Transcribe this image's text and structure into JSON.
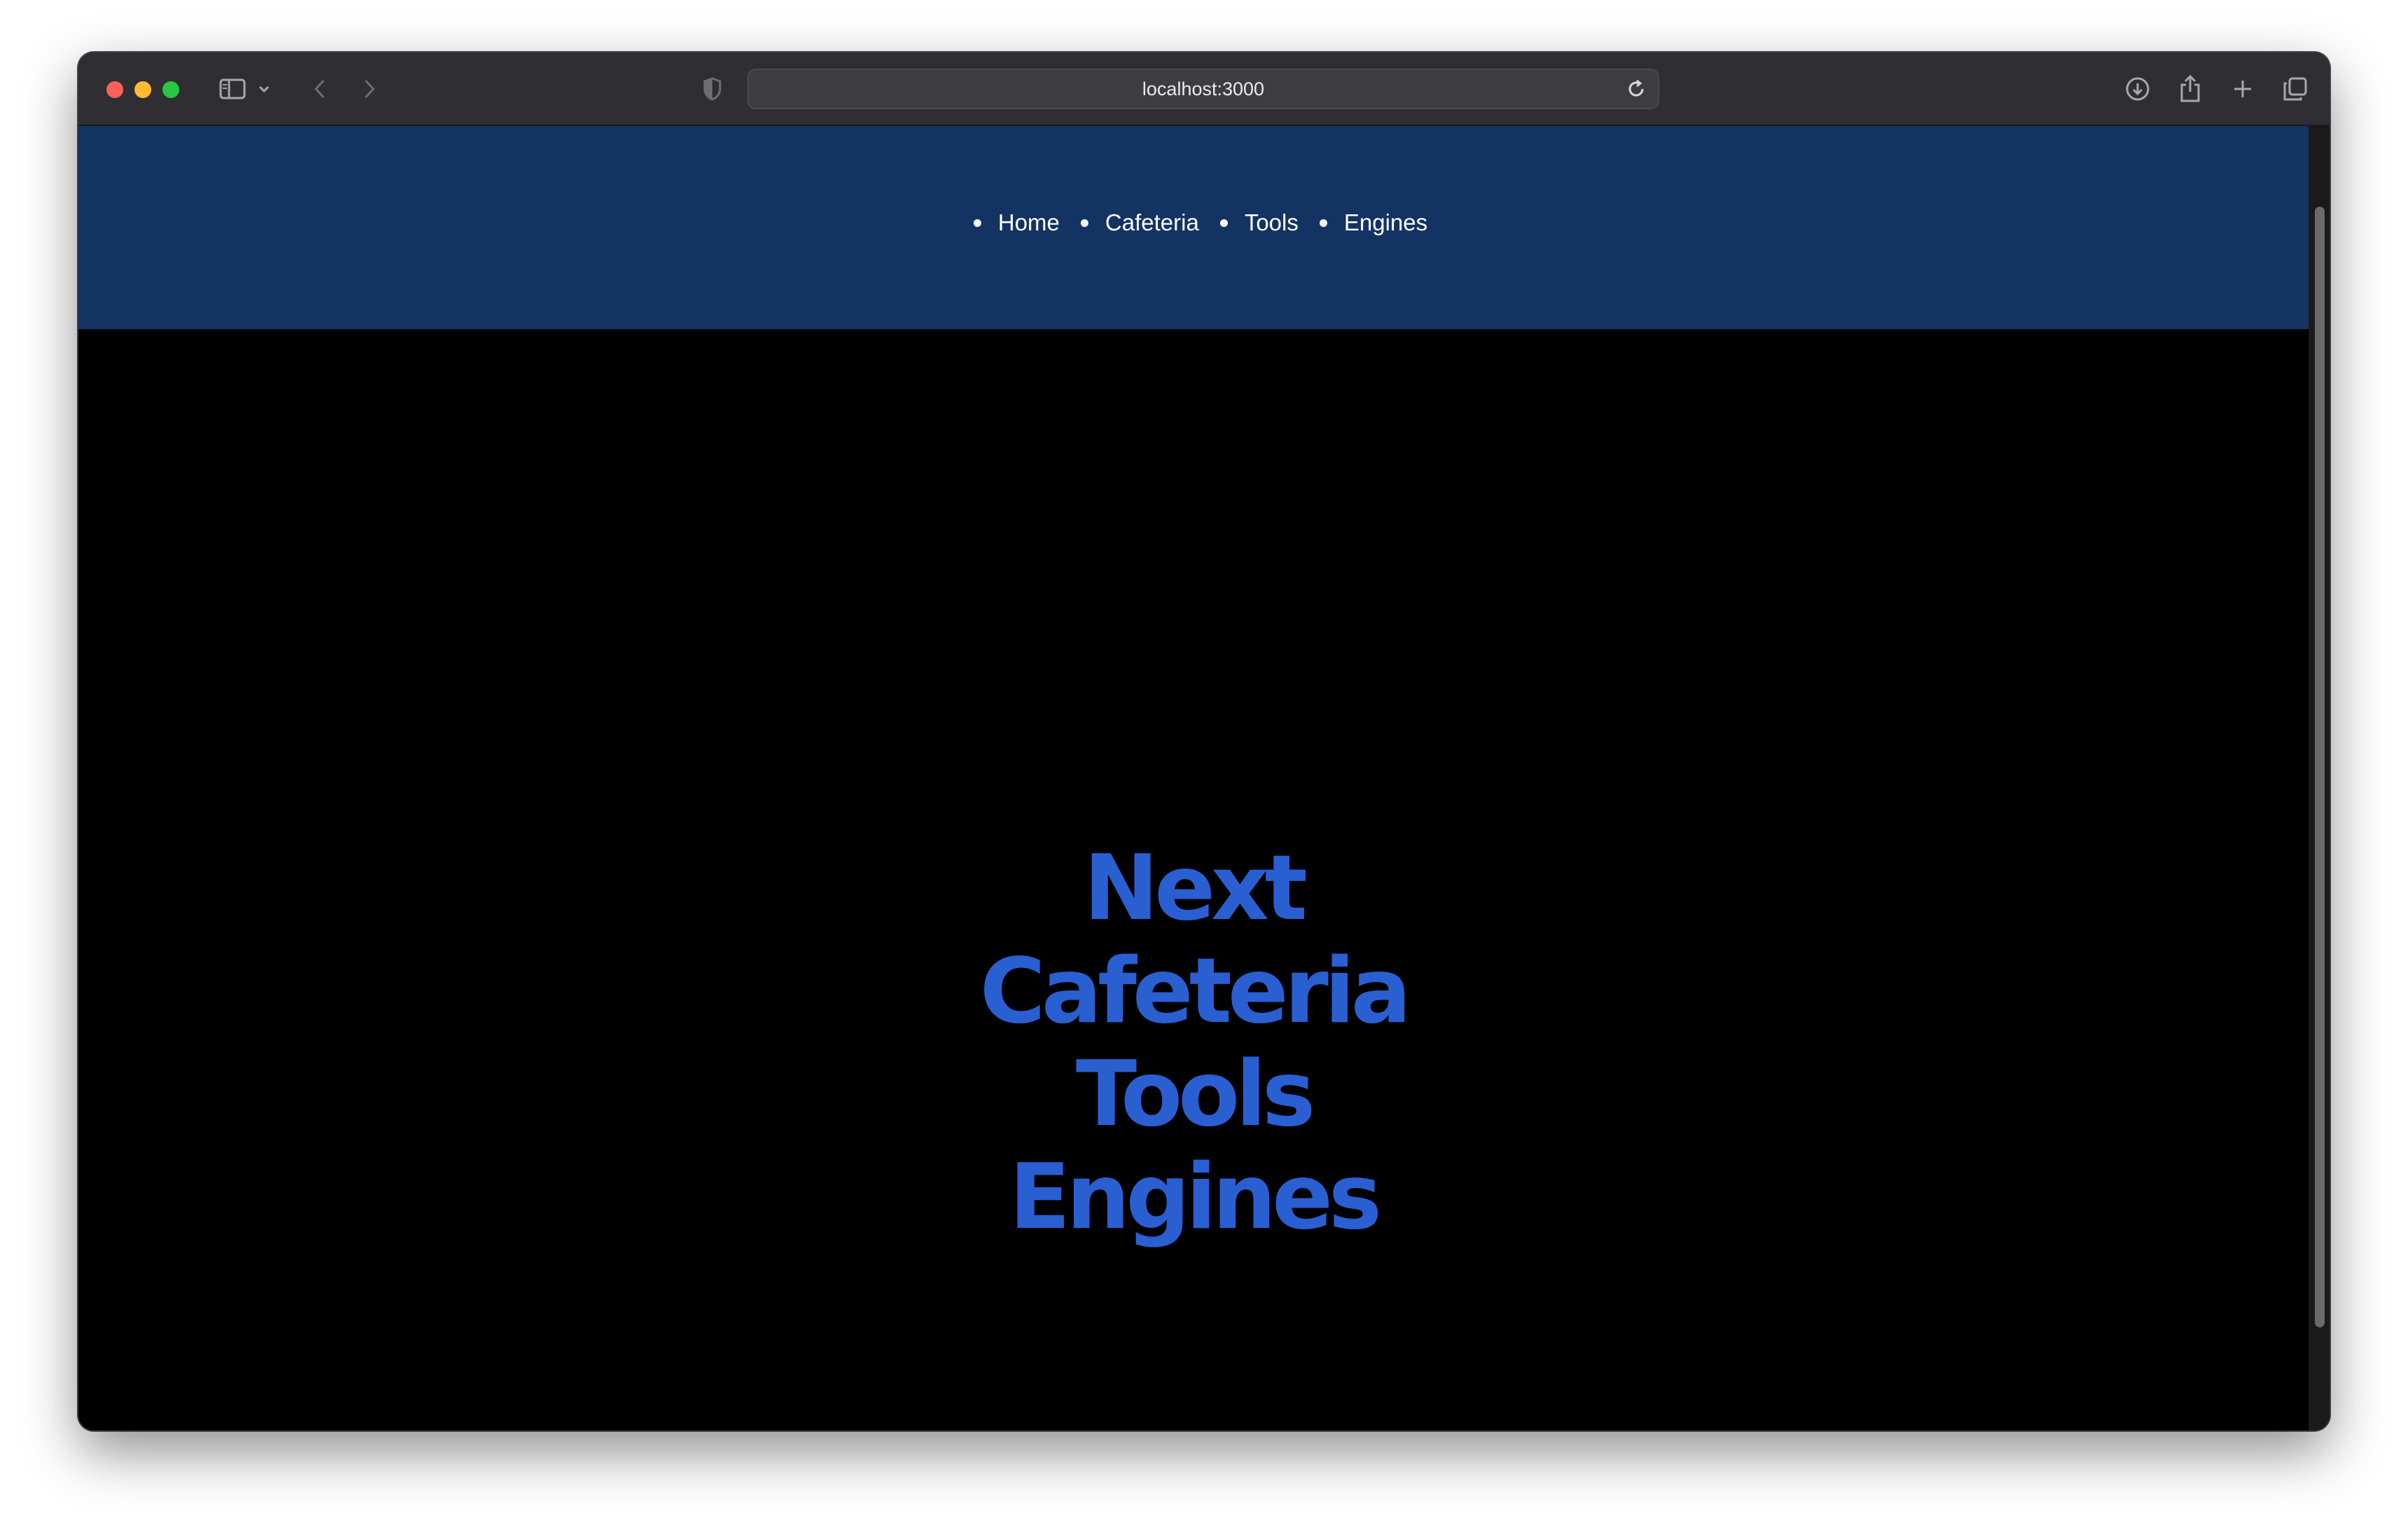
{
  "browser": {
    "url": "localhost:3000",
    "icons": {
      "sidebar": "sidebar-icon",
      "sidebar_menu": "chevron-down-icon",
      "back": "chevron-left-icon",
      "forward": "chevron-right-icon",
      "privacy": "shield-icon",
      "reload": "reload-icon",
      "downloads": "download-icon",
      "share": "share-icon",
      "new_tab": "plus-icon",
      "tabs_overview": "tabs-icon"
    }
  },
  "page": {
    "nav": [
      {
        "label": "Home"
      },
      {
        "label": "Cafeteria"
      },
      {
        "label": "Tools"
      },
      {
        "label": "Engines"
      }
    ],
    "hero_lines": [
      "Next",
      "Cafeteria",
      "Tools",
      "Engines"
    ],
    "colors": {
      "header_bg": "#133362",
      "page_bg": "#000000",
      "hero_text": "#2a5fd2"
    }
  }
}
